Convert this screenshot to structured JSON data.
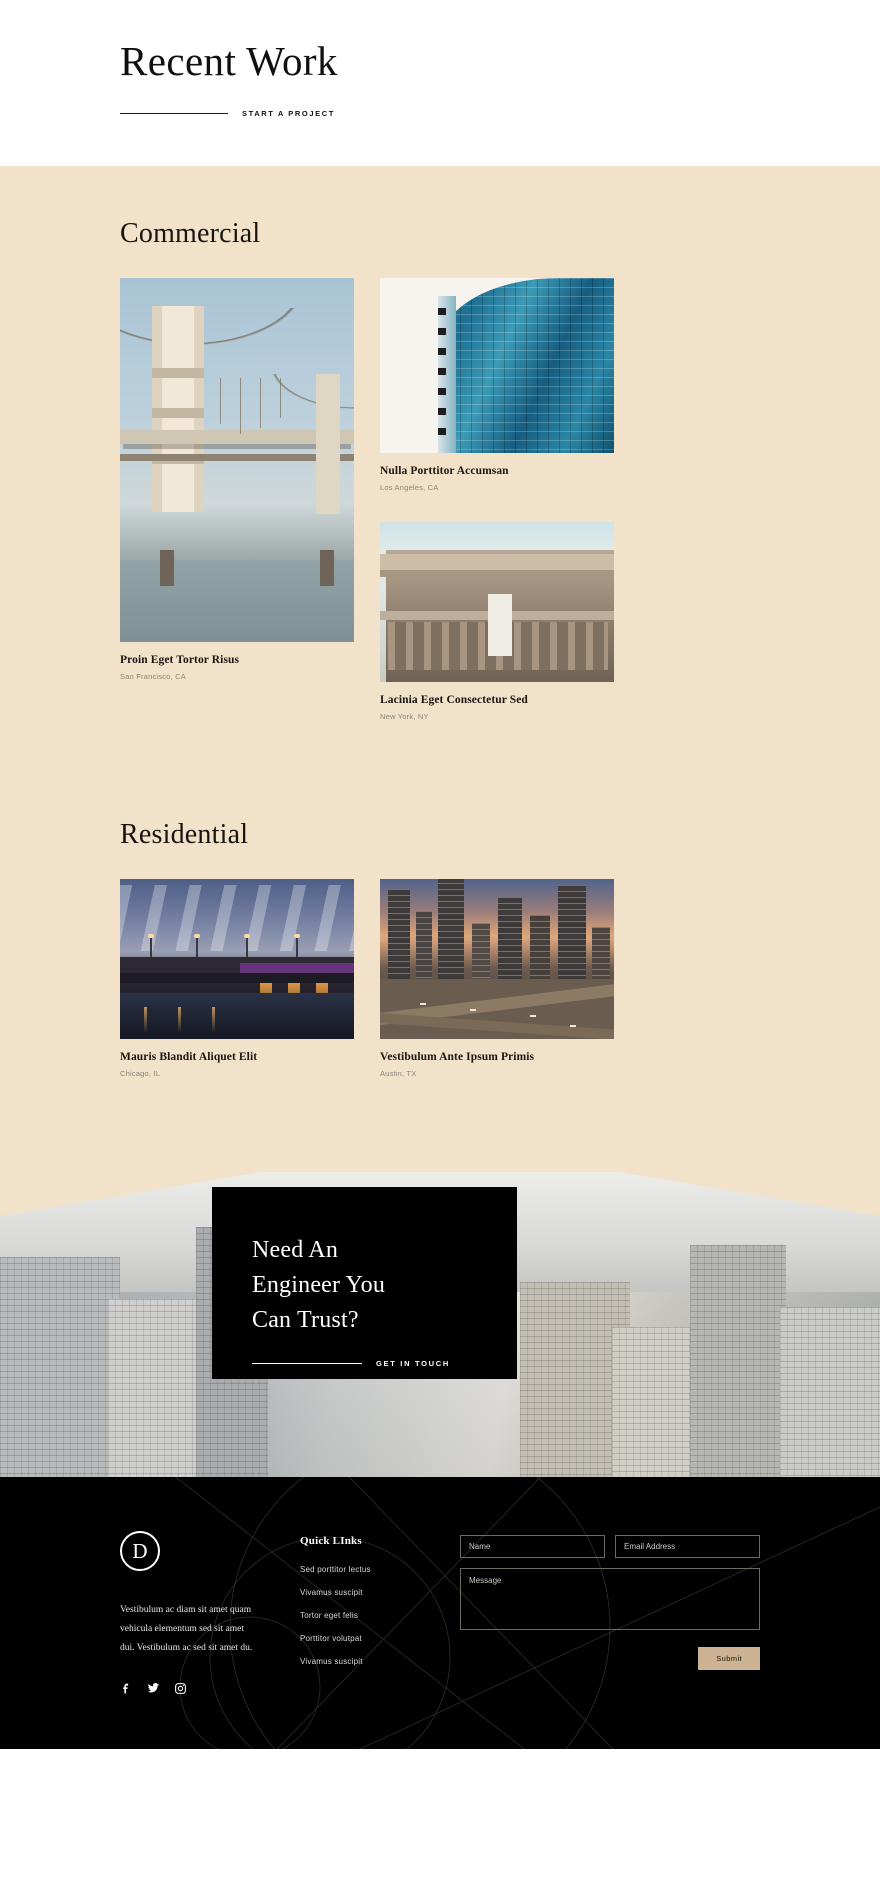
{
  "hero": {
    "title": "Recent Work",
    "cta_label": "START A PROJECT"
  },
  "sections": [
    {
      "id": "commercial",
      "title": "Commercial",
      "cards": [
        {
          "title": "Proin Eget Tortor Risus",
          "location": "San Francisco, CA"
        },
        {
          "title": "Nulla Porttitor Accumsan",
          "location": "Los Angeles, CA"
        },
        {
          "title": "Lacinia Eget Consectetur Sed",
          "location": "New York, NY"
        }
      ]
    },
    {
      "id": "residential",
      "title": "Residential",
      "cards": [
        {
          "title": "Mauris Blandit Aliquet Elit",
          "location": "Chicago, IL"
        },
        {
          "title": "Vestibulum Ante Ipsum Primis",
          "location": "Austin, TX"
        }
      ]
    }
  ],
  "cta": {
    "heading_line1": "Need An",
    "heading_line2": "Engineer You",
    "heading_line3": "Can Trust?",
    "link_label": "GET IN TOUCH"
  },
  "footer": {
    "logo_letter": "D",
    "description": "Vestibulum ac diam sit amet quam vehicula elementum sed sit amet dui. Vestibulum ac sed sit amet du.",
    "socials": [
      "facebook-icon",
      "twitter-icon",
      "instagram-icon"
    ],
    "links_title": "Quick LInks",
    "links": [
      "Sed porttitor lectus",
      "Vivamus suscipit",
      "Tortor eget felis",
      "Porttitor volutpat",
      "Vivamus suscipit"
    ],
    "form": {
      "name_placeholder": "Name",
      "email_placeholder": "Email Address",
      "message_placeholder": "Message",
      "submit_label": "Submit"
    }
  },
  "colors": {
    "beige": "#f2e2c9",
    "black": "#000000",
    "white": "#ffffff",
    "submit_tan": "#cdb394",
    "muted_text": "#8c8278"
  }
}
